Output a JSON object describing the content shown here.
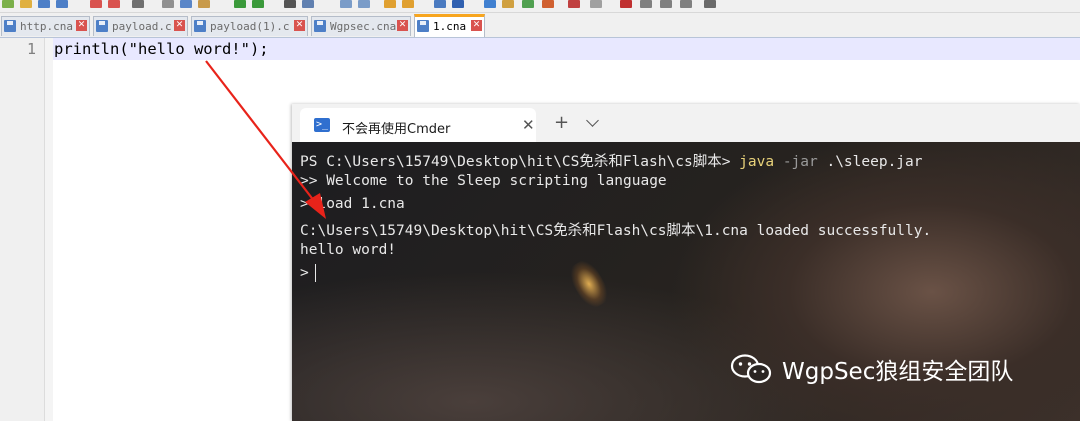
{
  "editor": {
    "tabs": [
      {
        "label": "http.cna"
      },
      {
        "label": "payload.c"
      },
      {
        "label": "payload(1).c"
      },
      {
        "label": "Wgpsec.cna"
      },
      {
        "label": "1.cna"
      }
    ],
    "active_tab_index": 4,
    "line_number": "1",
    "code": "println(\"hello word!\");",
    "colors": {
      "active_tab_accent": "#f7a51e",
      "current_line": "#e8e8ff",
      "arrow": "#e8231a"
    }
  },
  "cmder": {
    "tab_title": "不会再使用Cmder",
    "icons": [
      "powershell-icon",
      "close-icon",
      "new-tab-icon",
      "chevron-down-icon"
    ],
    "lines": {
      "l1_prompt": "PS C:\\Users\\15749\\Desktop\\hit\\CS免杀和Flash\\cs脚本>",
      "l1_cmd": "java",
      "l1_flag": "-jar",
      "l1_arg": ".\\sleep.jar",
      "l2": ">> Welcome to the Sleep scripting language",
      "l3": "> load 1.cna",
      "l4": "C:\\Users\\15749\\Desktop\\hit\\CS免杀和Flash\\cs脚本\\1.cna loaded successfully.",
      "l5": "hello word!",
      "l6": ">"
    }
  },
  "watermark": {
    "text": "WgpSec狼组安全团队",
    "icon": "wechat-icon"
  }
}
